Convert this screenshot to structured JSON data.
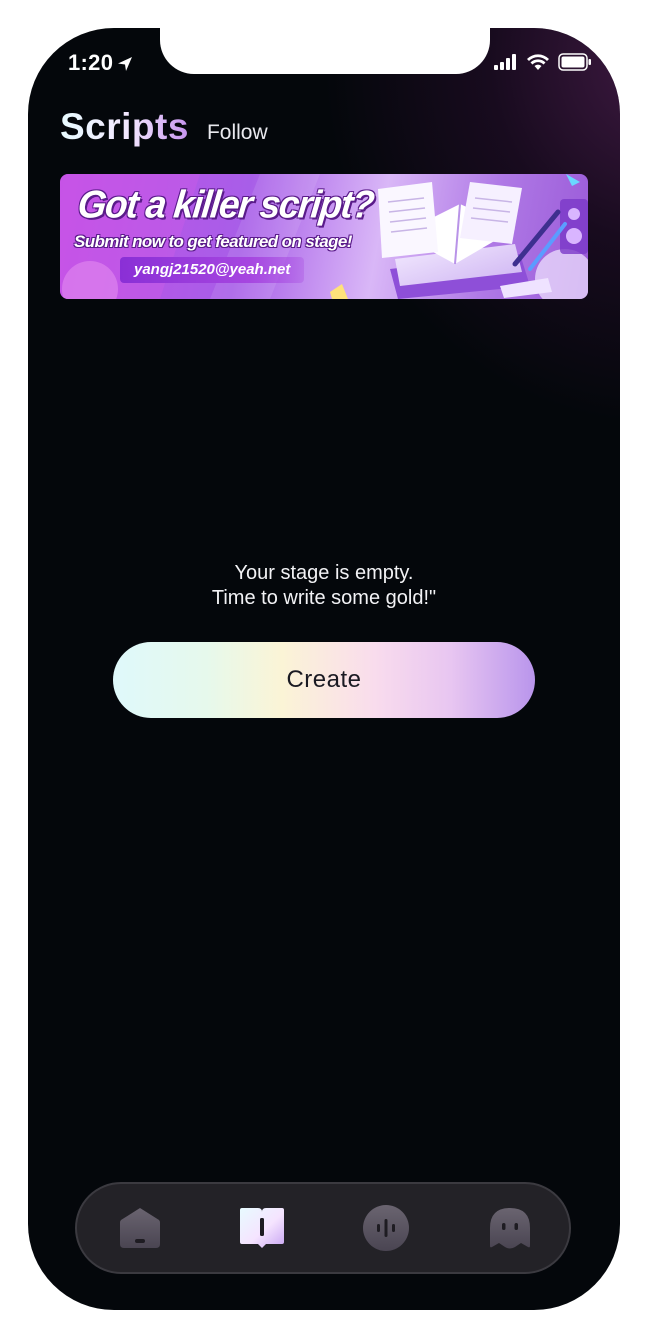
{
  "status_bar": {
    "time": "1:20",
    "icons": [
      "location-arrow-icon",
      "signal-icon",
      "wifi-icon",
      "battery-icon"
    ]
  },
  "header": {
    "title": "Scripts",
    "tabs": [
      "Scripts",
      "Follow"
    ],
    "follow_label": "Follow"
  },
  "banner": {
    "headline": "Got a killer script?",
    "subline": "Submit now to get featured on stage!",
    "email": "yangj21520@yeah.net"
  },
  "empty_state": {
    "line1": "Your stage is empty.",
    "line2": "Time to write some gold!\""
  },
  "create_button": {
    "label": "Create"
  },
  "tab_bar": {
    "items": [
      {
        "icon": "home-icon",
        "selected": false
      },
      {
        "icon": "book-icon",
        "selected": true
      },
      {
        "icon": "voice-icon",
        "selected": false
      },
      {
        "icon": "ghost-icon",
        "selected": false
      }
    ]
  },
  "colors": {
    "background": "#04070b",
    "accent": "#b995ec",
    "banner": "#a85ee8",
    "tabbar": "#232227"
  }
}
